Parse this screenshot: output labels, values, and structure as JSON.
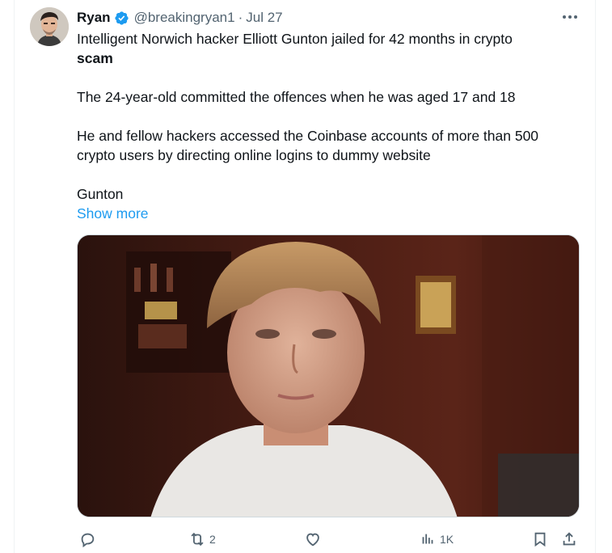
{
  "tweet": {
    "author_name": "Ryan",
    "handle": "@breakingryan1",
    "separator": "·",
    "date": "Jul 27",
    "line1": "Intelligent Norwich hacker Elliott Gunton jailed for 42 months in crypto",
    "line1_bold": "scam",
    "para2": "The 24-year-old committed the offences when he was aged 17 and 18",
    "para3_line1": "He and fellow hackers accessed the Coinbase accounts of more than 500",
    "para3_line2": "crypto users by directing online logins to dummy website",
    "para4": "Gunton",
    "show_more": "Show more"
  },
  "metrics": {
    "replies": "",
    "reposts": "2",
    "likes": "",
    "views": "1K"
  },
  "icons": {
    "verified": "verified-badge-icon",
    "more": "more-horizontal-icon",
    "reply": "reply-icon",
    "repost": "repost-icon",
    "like": "heart-icon",
    "views": "views-chart-icon",
    "bookmark": "bookmark-icon",
    "share": "share-icon"
  },
  "colors": {
    "text": "#0f1419",
    "secondary": "#536471",
    "accent": "#1d9bf0"
  }
}
